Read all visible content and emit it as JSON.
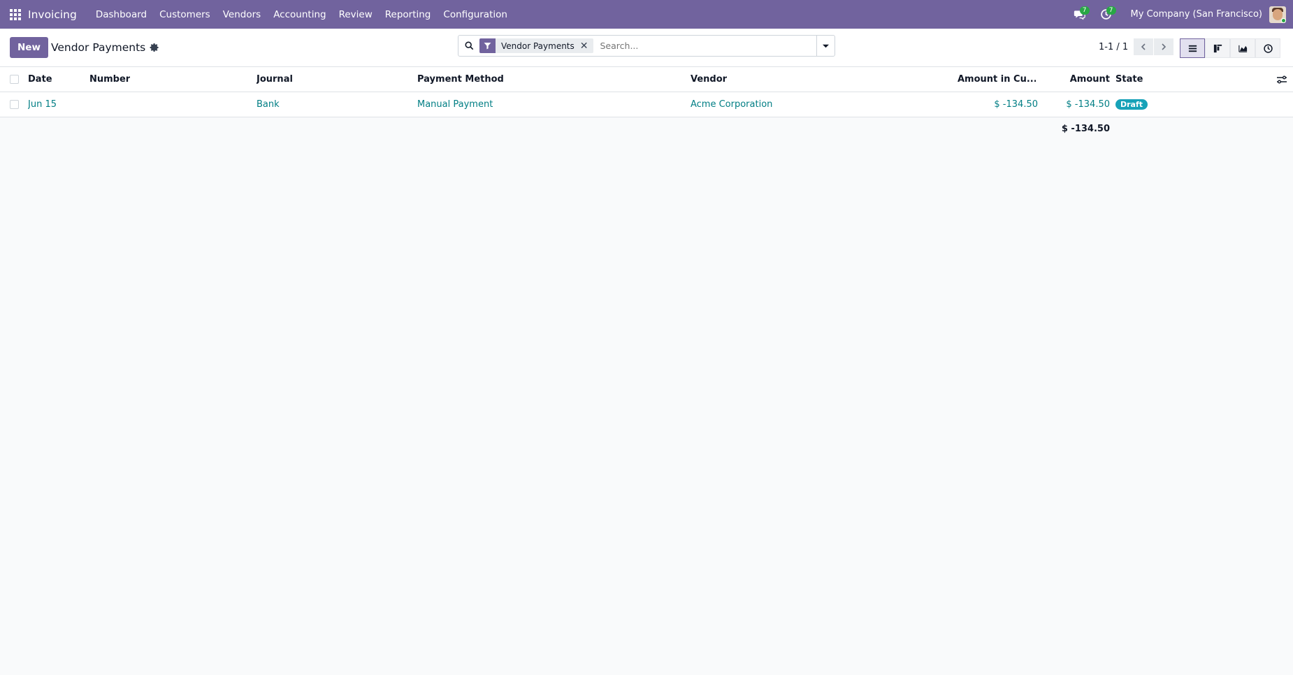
{
  "navbar": {
    "app_name": "Invoicing",
    "menu": [
      "Dashboard",
      "Customers",
      "Vendors",
      "Accounting",
      "Review",
      "Reporting",
      "Configuration"
    ],
    "messages_count": "7",
    "activities_count": "7",
    "company": "My Company (San Francisco)",
    "bg_color": "#71639e"
  },
  "control_panel": {
    "new_label": "New",
    "title": "Vendor Payments",
    "search": {
      "facet_label": "Vendor Payments",
      "placeholder": "Search...",
      "value": ""
    },
    "pager": "1-1 / 1",
    "views": [
      "list",
      "kanban",
      "graph",
      "activity"
    ],
    "active_view": "list"
  },
  "table": {
    "columns": {
      "date": "Date",
      "number": "Number",
      "journal": "Journal",
      "payment_method": "Payment Method",
      "vendor": "Vendor",
      "amount_currency": "Amount in Cu...",
      "amount": "Amount",
      "state": "State"
    },
    "rows": [
      {
        "date": "Jun 15",
        "number": "",
        "journal": "Bank",
        "payment_method": "Manual Payment",
        "vendor": "Acme Corporation",
        "amount_currency": "$ -134.50",
        "amount": "$ -134.50",
        "state": "Draft"
      }
    ],
    "total_amount": "$ -134.50"
  },
  "colors": {
    "link": "#017e84",
    "draft_badge": "#17a2b8",
    "primary": "#71639e"
  }
}
